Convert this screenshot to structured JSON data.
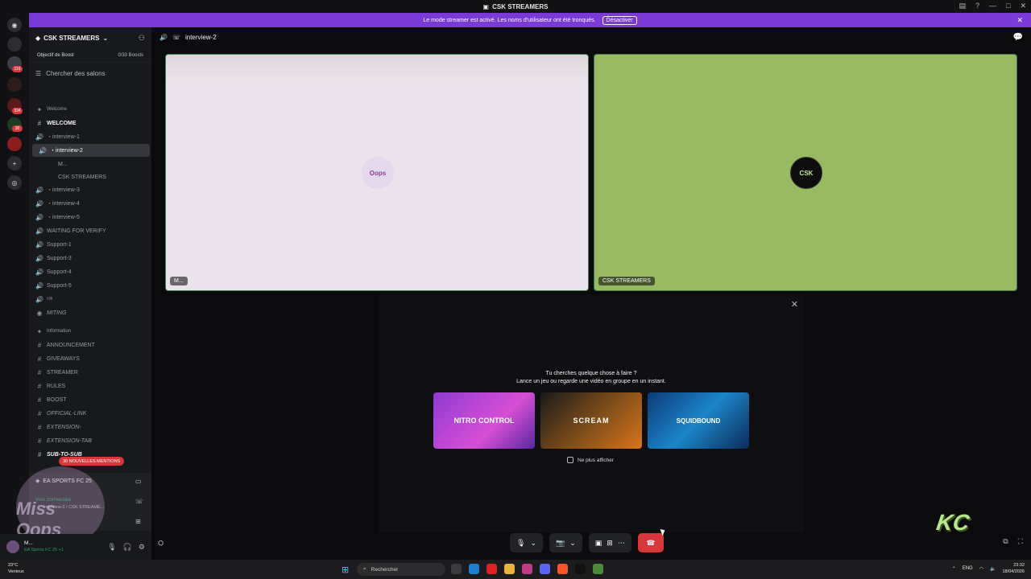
{
  "window": {
    "title": "CSK STREAMERS"
  },
  "notice": {
    "text": "Le mode streamer est activé. Les noms d'utilisateur ont été tronqués.",
    "button": "Désactiver"
  },
  "rail_badges": [
    "116",
    "334",
    "30"
  ],
  "guild": {
    "name": "CSK STREAMERS",
    "boost_label": "Objectif de Boost",
    "boost_count": "0/33 Boosts",
    "search_placeholder": "Chercher des salons"
  },
  "channels": [
    {
      "label": "Welcome",
      "icon": "✦",
      "type": "category"
    },
    {
      "label": "WELCOME",
      "icon": "#",
      "type": "text",
      "bold": true
    },
    {
      "label": "・interview-1",
      "icon": "🔊",
      "type": "voice"
    },
    {
      "label": "・interview-2",
      "icon": "🔊",
      "type": "voice",
      "active": true
    },
    {
      "label": "M...",
      "icon": "",
      "type": "member"
    },
    {
      "label": "CSK STREAMERS",
      "icon": "",
      "type": "member"
    },
    {
      "label": "・interview-3",
      "icon": "🔊",
      "type": "voice"
    },
    {
      "label": "・interview-4",
      "icon": "🔊",
      "type": "voice"
    },
    {
      "label": "・interview-5",
      "icon": "🔊",
      "type": "voice"
    },
    {
      "label": "WAITING FOR VERIFY",
      "icon": "🔊",
      "type": "voice"
    },
    {
      "label": "Support-1",
      "icon": "🔊",
      "type": "voice"
    },
    {
      "label": "Support-3",
      "icon": "🔊",
      "type": "voice"
    },
    {
      "label": "Support-4",
      "icon": "🔊",
      "type": "voice"
    },
    {
      "label": "Support-5",
      "icon": "🔊",
      "type": "voice"
    },
    {
      "label": "ᶜˢᵏ",
      "icon": "🔊",
      "type": "voice"
    },
    {
      "label": "MITING",
      "icon": "◉",
      "type": "stage",
      "italic": true
    },
    {
      "label": "Information",
      "icon": "✦",
      "type": "category"
    },
    {
      "label": "ANNOUNCEMENT",
      "icon": "#",
      "type": "text"
    },
    {
      "label": "GIVEAWAYS",
      "icon": "#",
      "type": "text"
    },
    {
      "label": "STREAMER",
      "icon": "#",
      "type": "text"
    },
    {
      "label": "RULES",
      "icon": "#",
      "type": "text"
    },
    {
      "label": "BOOST",
      "icon": "#",
      "type": "text"
    },
    {
      "label": "OFFICIAL-LINK",
      "icon": "#",
      "type": "text",
      "italic": true
    },
    {
      "label": "EXTENSION-",
      "icon": "#",
      "type": "text",
      "italic": true
    },
    {
      "label": "EXTENSION-TAB",
      "icon": "#",
      "type": "text",
      "italic": true
    },
    {
      "label": "SUB-TO-SUB",
      "icon": "#",
      "type": "text",
      "italic": true,
      "bold": true
    }
  ],
  "mentions": "30 NOUVELLES MENTIONS",
  "voice_panel": {
    "game": "EA SPORTS FC 25",
    "status": "Voix connectée",
    "channel": "interview-2 / CSK STREAME..."
  },
  "user": {
    "name": "M...",
    "status": "EA Sports FC 25 +1"
  },
  "call": {
    "channel": "interview-2",
    "tile_left_label": "M...",
    "tile_right_label": "CSK STREAMERS",
    "tile_left_avatar": "Oops",
    "tile_right_avatar": "CSK"
  },
  "activity": {
    "heading": "Tu cherches quelque chose à faire ?",
    "subheading": "Lance un jeu ou regarde une vidéo en groupe en un instant.",
    "cards": [
      "NITRO CONTROL",
      "SCREAM",
      "SQUIDBOUND"
    ],
    "dont_show": "Ne plus afficher"
  },
  "watermark": "Miss Oops",
  "taskbar": {
    "weather": "23°C",
    "weather_desc": "Venteux",
    "search": "Rechercher",
    "lang": "ENG",
    "time": "23:32",
    "date": "18/04/2026"
  },
  "colors": {
    "accent": "#5865f2",
    "banner": "#7a3ad8",
    "hangup": "#da373c",
    "connected": "#23a55a"
  }
}
